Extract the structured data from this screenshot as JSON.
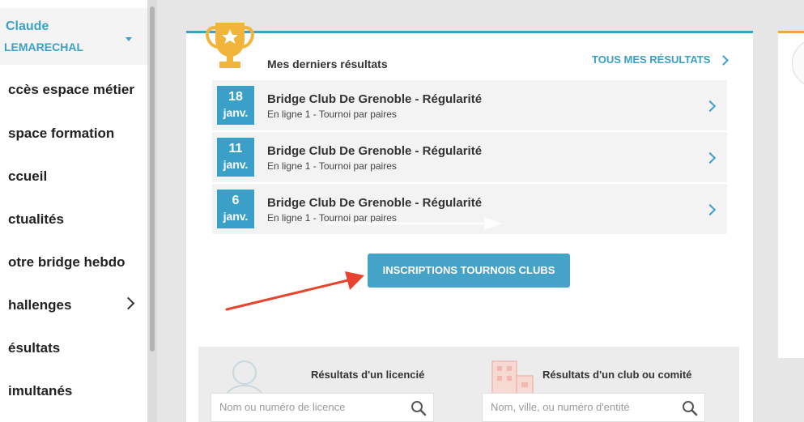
{
  "user": {
    "first_name": "Claude",
    "last_name": "LEMARECHAL"
  },
  "sidebar": {
    "items": [
      {
        "label": "ccès espace métier"
      },
      {
        "label": "space formation"
      },
      {
        "label": "ccueil"
      },
      {
        "label": "ctualités"
      },
      {
        "label": "otre bridge hebdo"
      },
      {
        "label": "hallenges"
      },
      {
        "label": "ésultats"
      },
      {
        "label": "imultanés"
      }
    ]
  },
  "results": {
    "title": "Mes derniers résultats",
    "all_link": "TOUS MES RÉSULTATS",
    "rows": [
      {
        "day": "18",
        "month": "janv.",
        "title": "Bridge Club De Grenoble - Régularité",
        "subtitle": "En ligne 1 - Tournoi par paires"
      },
      {
        "day": "11",
        "month": "janv.",
        "title": "Bridge Club De Grenoble - Régularité",
        "subtitle": "En ligne 1 - Tournoi par paires"
      },
      {
        "day": "6",
        "month": "janv.",
        "title": "Bridge Club De Grenoble - Régularité",
        "subtitle": "En ligne 1 - Tournoi par paires"
      }
    ]
  },
  "inscriptions_button": "INSCRIPTIONS TOURNOIS CLUBS",
  "search": {
    "licencie_label": "Résultats d'un licencié",
    "licencie_placeholder": "Nom ou numéro de licence",
    "club_label": "Résultats d'un club ou comité",
    "club_placeholder": "Nom, ville, ou numéro d'entité"
  },
  "colors": {
    "accent": "#3aa0c8",
    "annotation_arrow": "#e8432f",
    "trophy": "#f0b53a"
  }
}
